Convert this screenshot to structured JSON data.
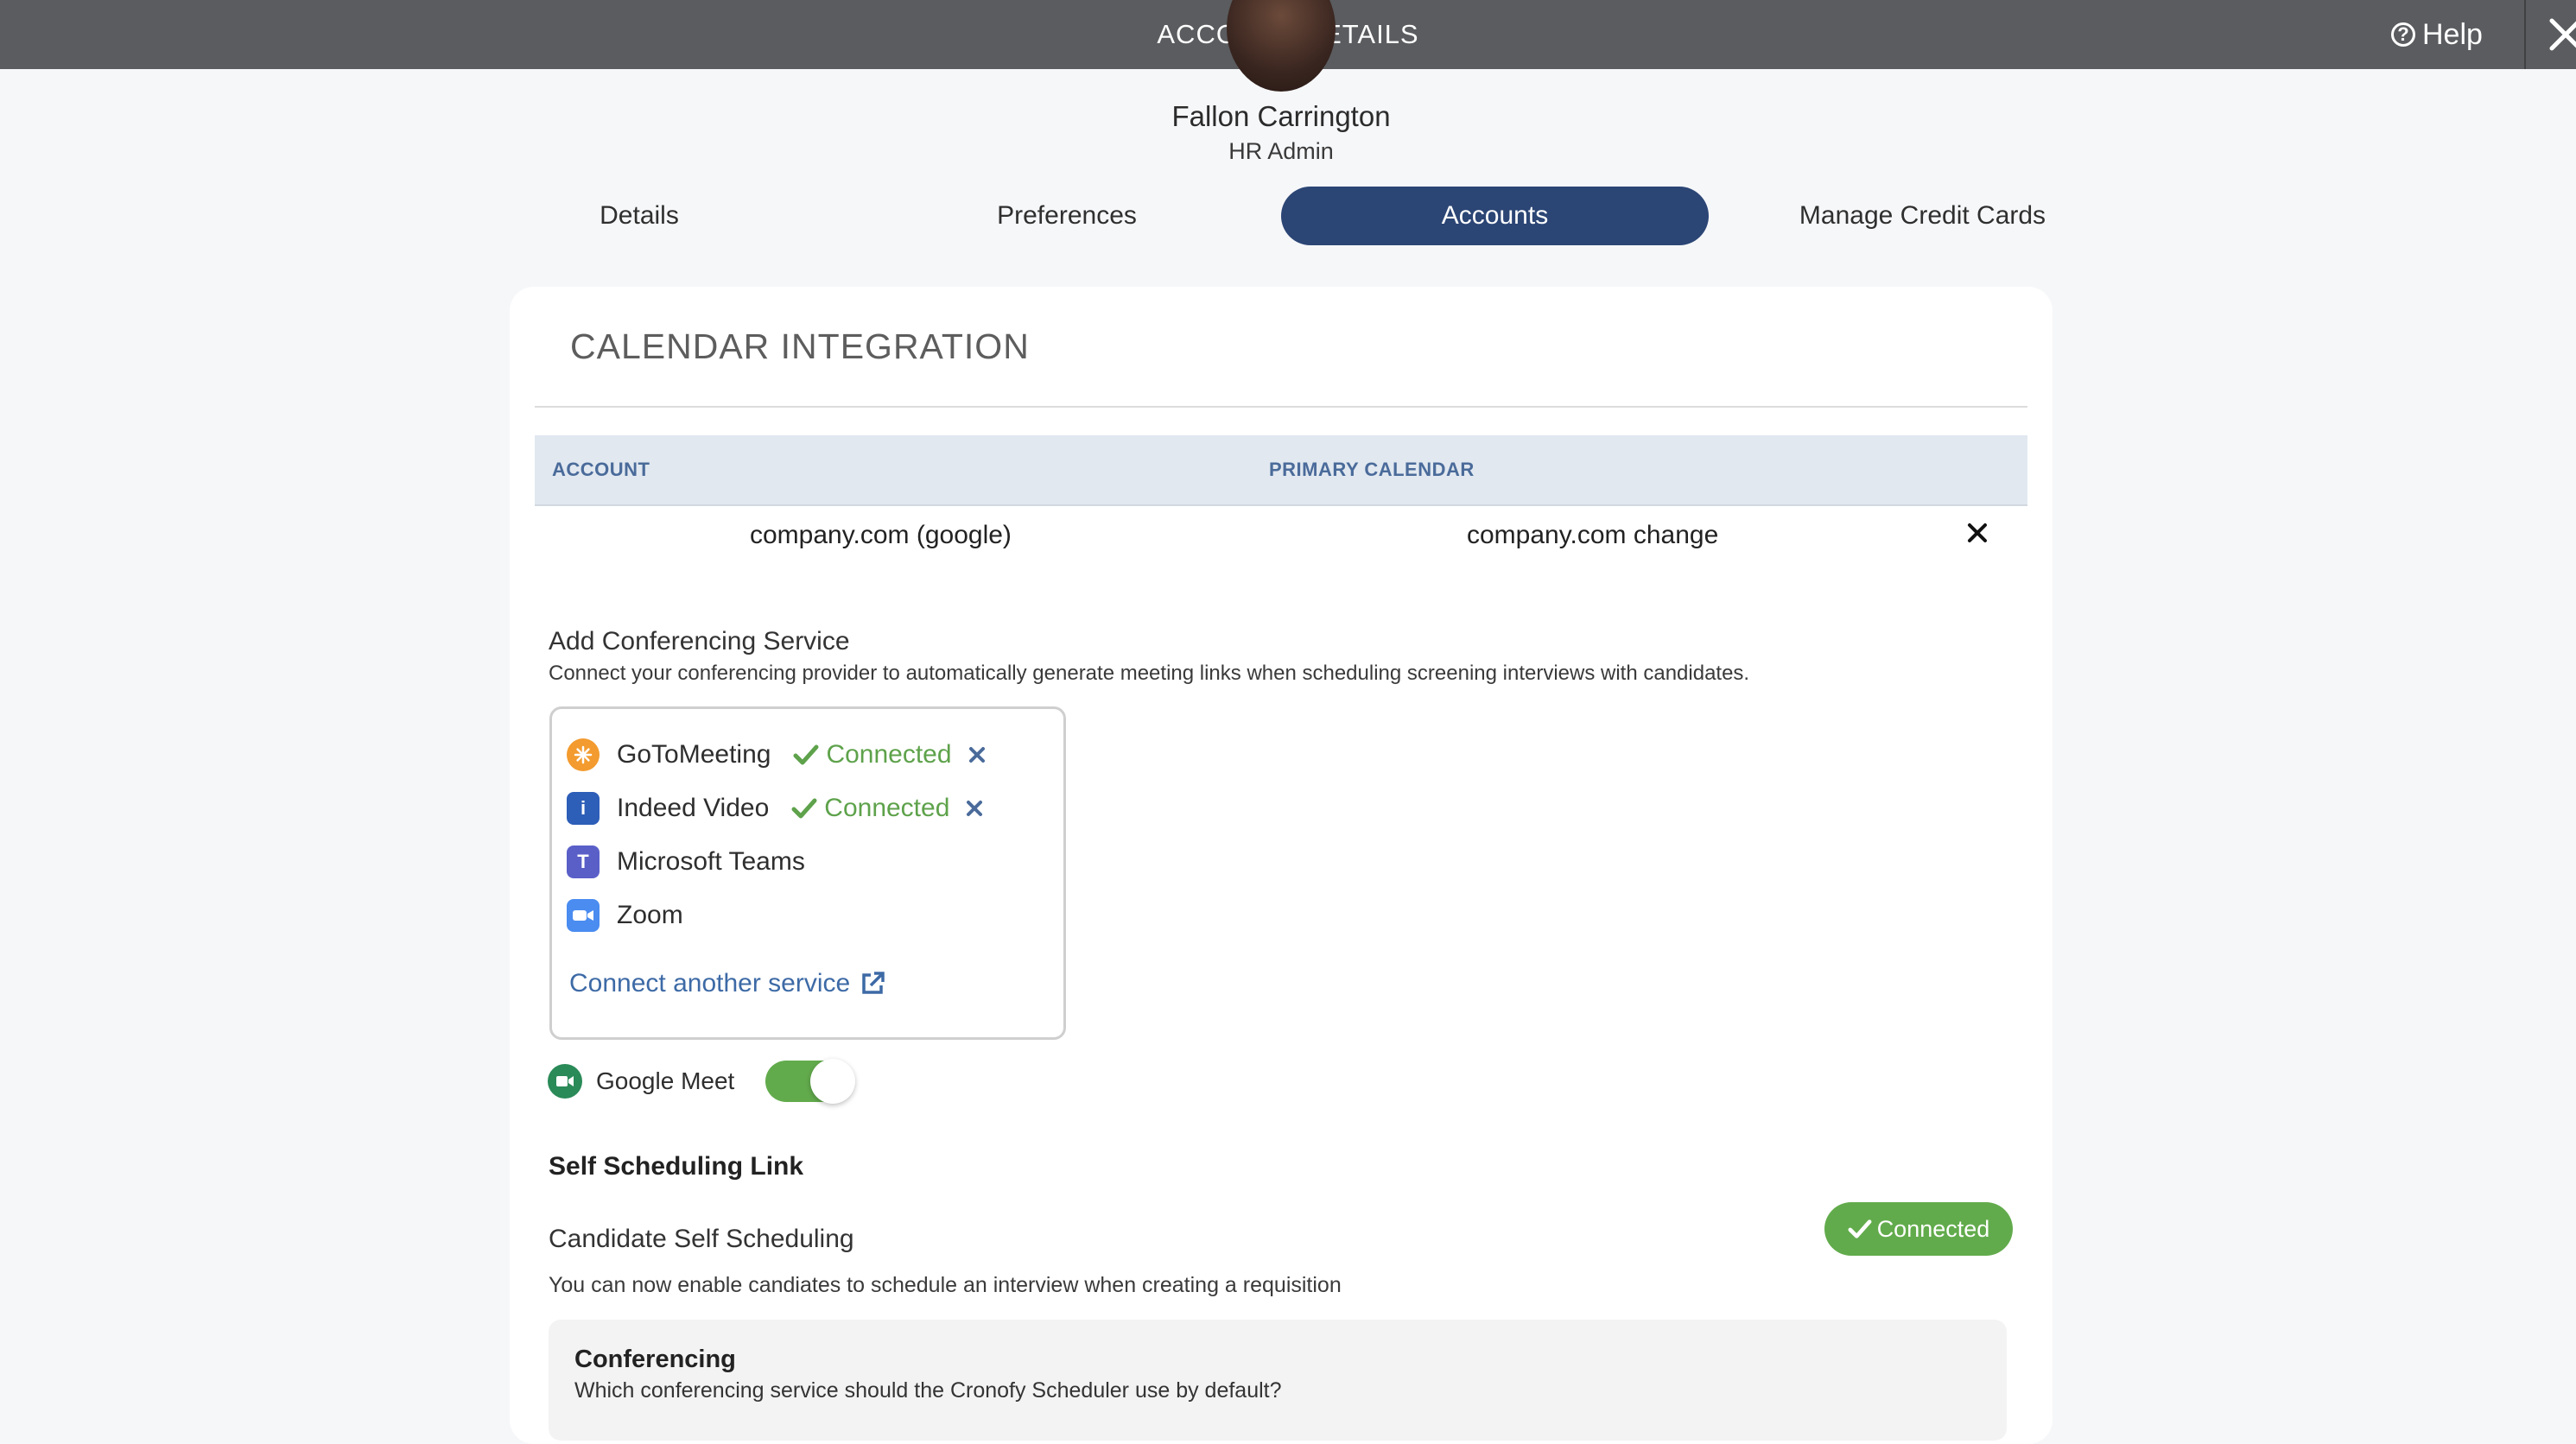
{
  "header": {
    "title": "ACCOUNT DETAILS",
    "help_label": "Help"
  },
  "profile": {
    "name": "Fallon Carrington",
    "role": "HR Admin"
  },
  "tabs": [
    {
      "label": "Details",
      "active": false
    },
    {
      "label": "Preferences",
      "active": false
    },
    {
      "label": "Accounts",
      "active": true
    },
    {
      "label": "Manage Credit Cards",
      "active": false
    }
  ],
  "calendar": {
    "title": "CALENDAR INTEGRATION",
    "columns": [
      "ACCOUNT",
      "PRIMARY CALENDAR"
    ],
    "row": {
      "account": "company.com (google)",
      "primary_calendar": "company.com",
      "change_label": "change"
    }
  },
  "conferencing": {
    "heading": "Add Conferencing Service",
    "description": "Connect your conferencing provider to automatically generate meeting links when scheduling screening interviews with candidates.",
    "services": [
      {
        "name": "GoToMeeting",
        "status": "Connected",
        "icon": "gotomeeting-icon"
      },
      {
        "name": "Indeed Video",
        "status": "Connected",
        "icon": "indeed-video-icon"
      },
      {
        "name": "Microsoft Teams",
        "status": "",
        "icon": "microsoft-teams-icon"
      },
      {
        "name": "Zoom",
        "status": "",
        "icon": "zoom-icon"
      }
    ],
    "connect_link": "Connect another service",
    "google_meet": {
      "label": "Google Meet",
      "enabled": true
    }
  },
  "self_scheduling": {
    "title": "Self Scheduling Link",
    "subtitle": "Candidate Self Scheduling",
    "status": "Connected",
    "description": "You can now enable candiates to schedule an interview when creating a requisition"
  },
  "conferencing_panel": {
    "title": "Conferencing",
    "description": "Which conferencing service should the Cronofy Scheduler use by default?"
  },
  "colors": {
    "header": "#5a5c5f",
    "active_tab": "#2b4575",
    "success": "#62ab4c",
    "link": "#3d6aa6"
  }
}
